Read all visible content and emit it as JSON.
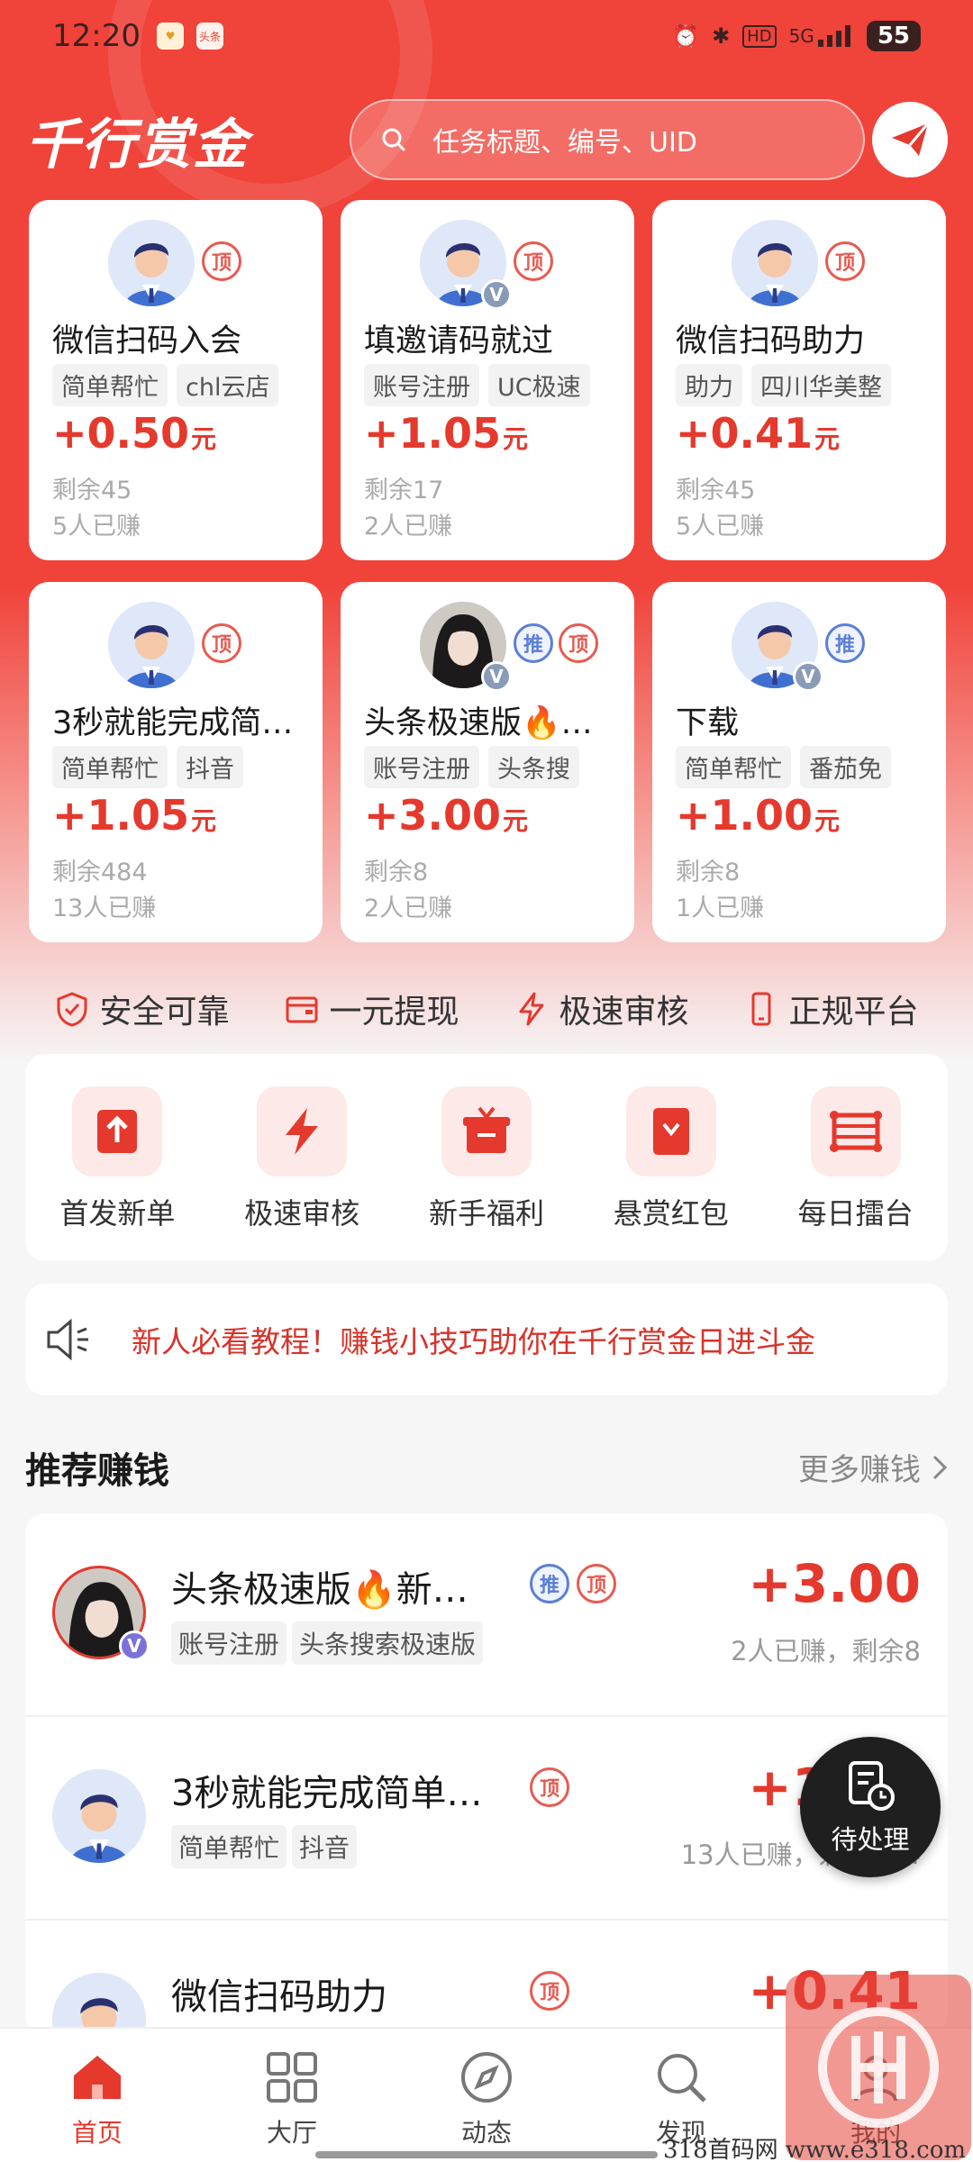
{
  "status_bar": {
    "time": "12:20",
    "network": "5G",
    "hd": "HD",
    "battery": "55",
    "app_badge": "头条"
  },
  "header": {
    "brand": "千行赏金",
    "search_placeholder": "任务标题、编号、UID"
  },
  "task_cards": [
    {
      "title": "微信扫码入会",
      "tags": [
        "简单帮忙",
        "chl云店"
      ],
      "price": "+0.50",
      "unit": "元",
      "remaining": "剩余45",
      "earned": "5人已赚",
      "badges": [
        "顶"
      ],
      "verified": false,
      "avatar": "male-avatar"
    },
    {
      "title": "填邀请码就过",
      "tags": [
        "账号注册",
        "UC极速"
      ],
      "price": "+1.05",
      "unit": "元",
      "remaining": "剩余17",
      "earned": "2人已赚",
      "badges": [
        "顶"
      ],
      "verified": true,
      "avatar": "male-avatar"
    },
    {
      "title": "微信扫码助力",
      "tags": [
        "助力",
        "四川华美整"
      ],
      "price": "+0.41",
      "unit": "元",
      "remaining": "剩余45",
      "earned": "5人已赚",
      "badges": [
        "顶"
      ],
      "verified": false,
      "avatar": "male-avatar"
    },
    {
      "title": "3秒就能完成简…",
      "tags": [
        "简单帮忙",
        "抖音"
      ],
      "price": "+1.05",
      "unit": "元",
      "remaining": "剩余484",
      "earned": "13人已赚",
      "badges": [
        "顶"
      ],
      "verified": false,
      "avatar": "male-avatar"
    },
    {
      "title": "头条极速版🔥…",
      "tags": [
        "账号注册",
        "头条搜"
      ],
      "price": "+3.00",
      "unit": "元",
      "remaining": "剩余8",
      "earned": "2人已赚",
      "badges": [
        "推",
        "顶"
      ],
      "verified": true,
      "avatar": "photo-avatar"
    },
    {
      "title": "下载",
      "tags": [
        "简单帮忙",
        "番茄免"
      ],
      "price": "+1.00",
      "unit": "元",
      "remaining": "剩余8",
      "earned": "1人已赚",
      "badges": [
        "推"
      ],
      "verified": true,
      "avatar": "male-avatar"
    }
  ],
  "guarantees": [
    "安全可靠",
    "一元提现",
    "极速审核",
    "正规平台"
  ],
  "quick_menu": [
    "首发新单",
    "极速审核",
    "新手福利",
    "悬赏红包",
    "每日擂台"
  ],
  "notice": "新人必看教程！赚钱小技巧助你在千行赏金日进斗金",
  "section": {
    "title": "推荐赚钱",
    "more": "更多赚钱"
  },
  "recommend_list": [
    {
      "title": "头条极速版🔥新…",
      "tags": [
        "账号注册",
        "头条搜索极速版"
      ],
      "price": "+3.00",
      "meta": "2人已赚，剩余8",
      "badges": [
        "推",
        "顶"
      ]
    },
    {
      "title": "3秒就能完成简单…",
      "tags": [
        "简单帮忙",
        "抖音"
      ],
      "price": "+1.05",
      "meta": "13人已赚，剩余484",
      "badges": [
        "顶"
      ]
    },
    {
      "title": "微信扫码助力",
      "tags": [],
      "price": "+0.41",
      "meta": "",
      "badges": [
        "顶"
      ]
    }
  ],
  "pending": "待处理",
  "bottom_nav": [
    "首页",
    "大厅",
    "动态",
    "发现",
    "我的"
  ],
  "watermark": "318首码网 www.e318.com",
  "colors": {
    "brand_red": "#f0433a",
    "price_red": "#e5392d",
    "push_blue": "#5b7fd6"
  }
}
